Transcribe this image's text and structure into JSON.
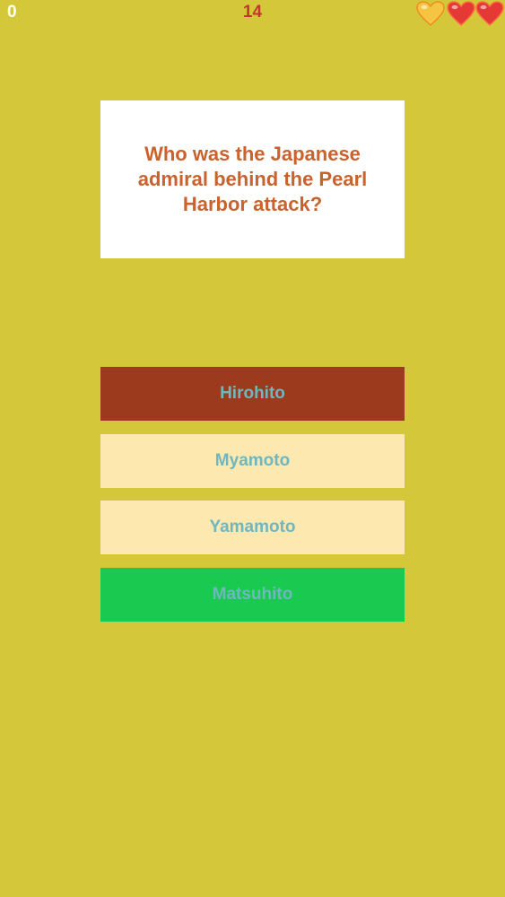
{
  "hud": {
    "score": "0",
    "timer": "14",
    "lives": [
      {
        "state": "used",
        "color": "#f5c542"
      },
      {
        "state": "full",
        "color": "#e53935"
      },
      {
        "state": "full",
        "color": "#e53935"
      }
    ]
  },
  "question": {
    "text": "Who was the Japanese admiral behind the Pearl Harbor attack?"
  },
  "answers": [
    {
      "label": "Hirohito",
      "state": "wrong",
      "color": "#9c3a1d"
    },
    {
      "label": "Myamoto",
      "state": "neutral",
      "color": "#fde8b0"
    },
    {
      "label": "Yamamoto",
      "state": "neutral",
      "color": "#fde8b0"
    },
    {
      "label": "Matsuhito",
      "state": "correct",
      "color": "#1ac94f"
    }
  ],
  "colors": {
    "background": "#d4c83a",
    "question_text": "#c9622c",
    "answer_text": "#6fb7c0",
    "timer": "#c0392b"
  }
}
